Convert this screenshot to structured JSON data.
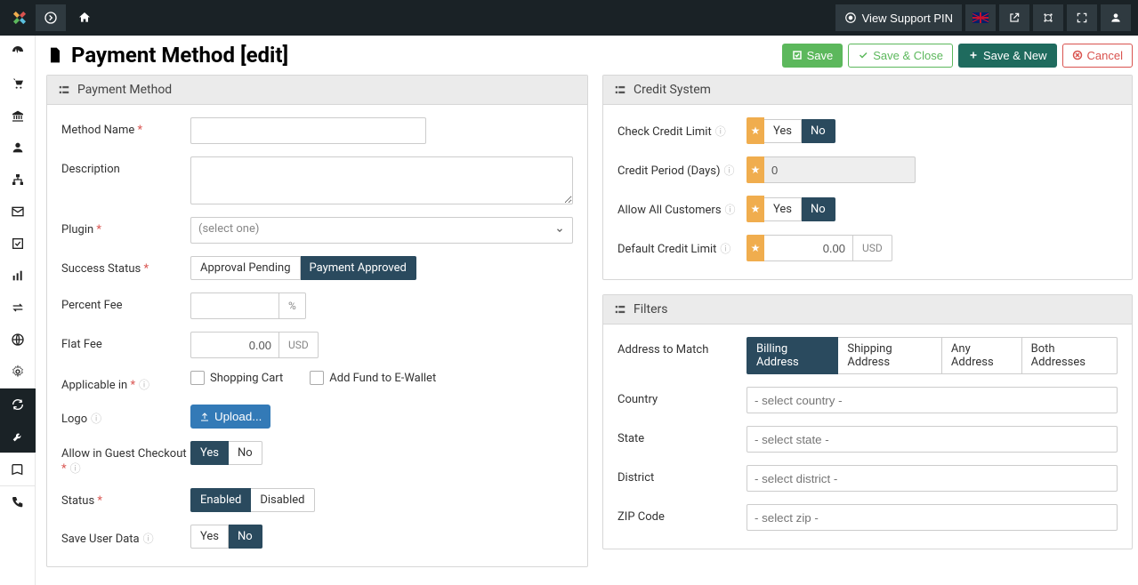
{
  "topbar": {
    "support_pin_label": "View Support PIN"
  },
  "page": {
    "title": "Payment Method [edit]"
  },
  "actions": {
    "save": "Save",
    "save_close": "Save & Close",
    "save_new": "Save & New",
    "cancel": "Cancel"
  },
  "panel_payment": {
    "title": "Payment Method",
    "fields": {
      "method_name": {
        "label": "Method Name",
        "value": ""
      },
      "description": {
        "label": "Description",
        "value": ""
      },
      "plugin": {
        "label": "Plugin",
        "placeholder": "(select one)"
      },
      "success_status": {
        "label": "Success Status",
        "opt1": "Approval Pending",
        "opt2": "Payment Approved"
      },
      "percent_fee": {
        "label": "Percent Fee",
        "value": "",
        "unit": "%"
      },
      "flat_fee": {
        "label": "Flat Fee",
        "value": "0.00",
        "unit": "USD"
      },
      "applicable_in": {
        "label": "Applicable in",
        "opt1": "Shopping Cart",
        "opt2": "Add Fund to E-Wallet"
      },
      "logo": {
        "label": "Logo",
        "btn": "Upload..."
      },
      "allow_guest": {
        "label": "Allow in Guest Checkout",
        "yes": "Yes",
        "no": "No"
      },
      "status": {
        "label": "Status",
        "enabled": "Enabled",
        "disabled": "Disabled"
      },
      "save_user_data": {
        "label": "Save User Data",
        "yes": "Yes",
        "no": "No"
      }
    }
  },
  "panel_credit": {
    "title": "Credit System",
    "fields": {
      "check_limit": {
        "label": "Check Credit Limit",
        "yes": "Yes",
        "no": "No"
      },
      "credit_period": {
        "label": "Credit Period (Days)",
        "value": "0"
      },
      "allow_all": {
        "label": "Allow All Customers",
        "yes": "Yes",
        "no": "No"
      },
      "default_limit": {
        "label": "Default Credit Limit",
        "value": "0.00",
        "unit": "USD"
      }
    }
  },
  "panel_filters": {
    "title": "Filters",
    "fields": {
      "address_match": {
        "label": "Address to Match",
        "opt1": "Billing Address",
        "opt2": "Shipping Address",
        "opt3": "Any Address",
        "opt4": "Both Addresses"
      },
      "country": {
        "label": "Country",
        "placeholder": "- select country -"
      },
      "state": {
        "label": "State",
        "placeholder": "- select state -"
      },
      "district": {
        "label": "District",
        "placeholder": "- select district -"
      },
      "zip": {
        "label": "ZIP Code",
        "placeholder": "- select zip -"
      }
    }
  }
}
